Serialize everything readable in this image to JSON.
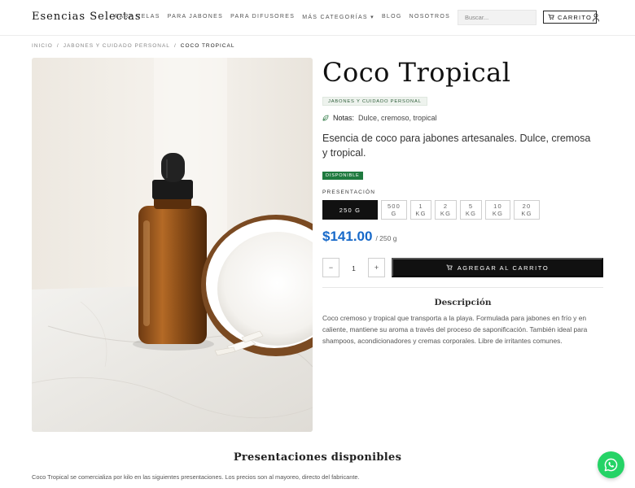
{
  "site": {
    "logo": "Esencias Selectas"
  },
  "nav": {
    "items": [
      {
        "label": "PARA VELAS"
      },
      {
        "label": "PARA JABONES"
      },
      {
        "label": "PARA DIFUSORES"
      },
      {
        "label": "MÁS CATEGORÍAS ▾"
      },
      {
        "label": "BLOG"
      },
      {
        "label": "NOSOTROS"
      }
    ]
  },
  "search": {
    "placeholder": "Buscar..."
  },
  "cart": {
    "label": "CARRITO",
    "icon": "cart-icon"
  },
  "user": {
    "icon": "user-icon"
  },
  "breadcrumb": {
    "home": "INICIO",
    "sep1": "/",
    "category": "JABONES Y CUIDADO PERSONAL",
    "sep2": "/",
    "current": "COCO TROPICAL"
  },
  "product": {
    "title": "Coco Tropical",
    "category": "JABONES Y CUIDADO PERSONAL",
    "notes_label": "Notas:",
    "notes_value": "Dulce, cremoso, tropical",
    "lead": "Esencia de coco para jabones artesanales. Dulce, cremosa y tropical.",
    "status": "DISPONIBLE",
    "presentation_label": "PRESENTACIÓN",
    "sizes": [
      {
        "label": "250 G",
        "selected": true
      },
      {
        "label": "500 G",
        "selected": false
      },
      {
        "label": "1 KG",
        "selected": false
      },
      {
        "label": "2 KG",
        "selected": false
      },
      {
        "label": "5 KG",
        "selected": false
      },
      {
        "label": "10 KG",
        "selected": false
      },
      {
        "label": "20 KG",
        "selected": false
      }
    ],
    "price": "$141.00",
    "price_unit": "/ 250 g",
    "quantity": "1",
    "qty_minus": "−",
    "qty_plus": "+",
    "add_to_cart": "AGREGAR AL CARRITO",
    "description_heading": "Descripción",
    "description": "Coco cremoso y tropical que transporta a la playa. Formulada para jabones en frío y en caliente, mantiene su aroma a través del proceso de saponificación. También ideal para shampoos, acondicionadores y cremas corporales. Libre de irritantes comunes."
  },
  "presentations": {
    "heading": "Presentaciones disponibles",
    "subtext": "Coco Tropical se comercializa por kilo en las siguientes presentaciones. Los precios son al mayoreo, directo del fabricante."
  },
  "colors": {
    "accent_price": "#1769c9",
    "status_green": "#1f7a3f",
    "whatsapp": "#25d366",
    "button_dark": "#111111"
  }
}
